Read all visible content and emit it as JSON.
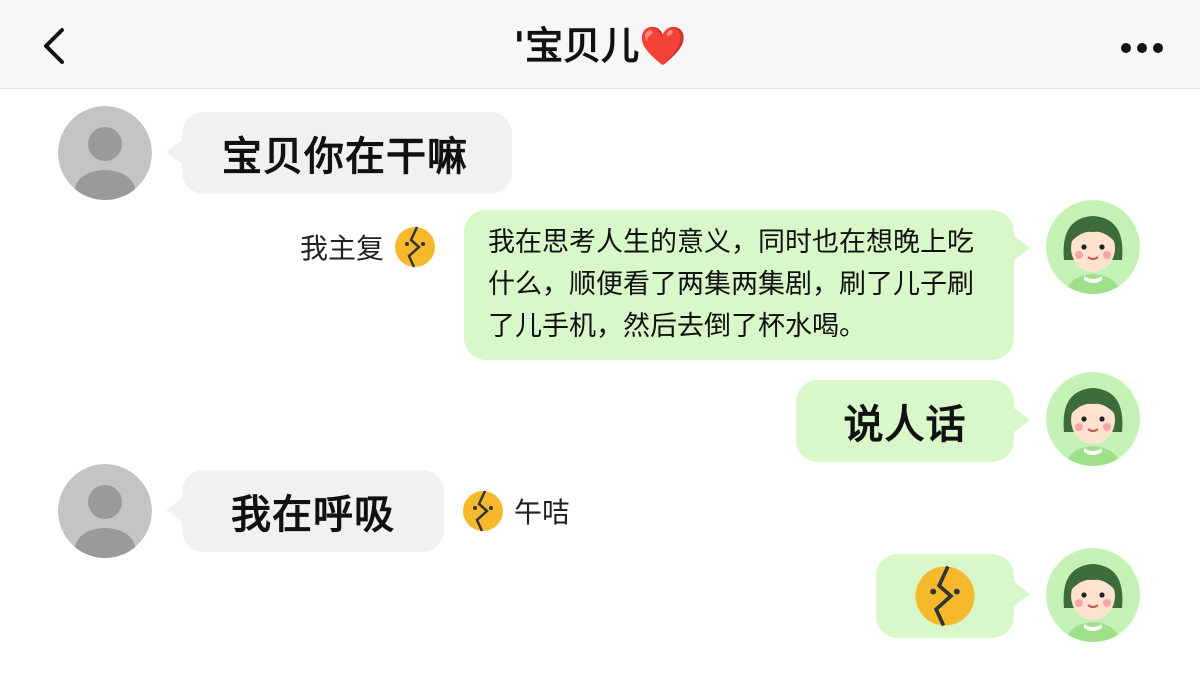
{
  "header": {
    "title": "'宝贝儿",
    "heart": "❤️",
    "back_icon": "chevron-left-icon",
    "more_icon": "more-dots-icon"
  },
  "messages": [
    {
      "side": "left",
      "text": "宝贝你在干嘛"
    },
    {
      "side": "right",
      "text": "我在思考人生的意义，同时也在想晚上吃什么，顺便看了两集两集剧，刷了儿子刷了儿手机，然后去倒了杯水喝。",
      "reaction_text": "我主复"
    },
    {
      "side": "right",
      "text": "说人话"
    },
    {
      "side": "left",
      "text": "我在呼吸",
      "reaction_text": "午咭"
    },
    {
      "side": "right",
      "emoji": "broken-face-emoji"
    }
  ],
  "colors": {
    "left_bubble": "#f1f1f1",
    "right_bubble": "#d8f8c9",
    "heart": "#e8101e",
    "header_bg": "#f7f7f7"
  }
}
